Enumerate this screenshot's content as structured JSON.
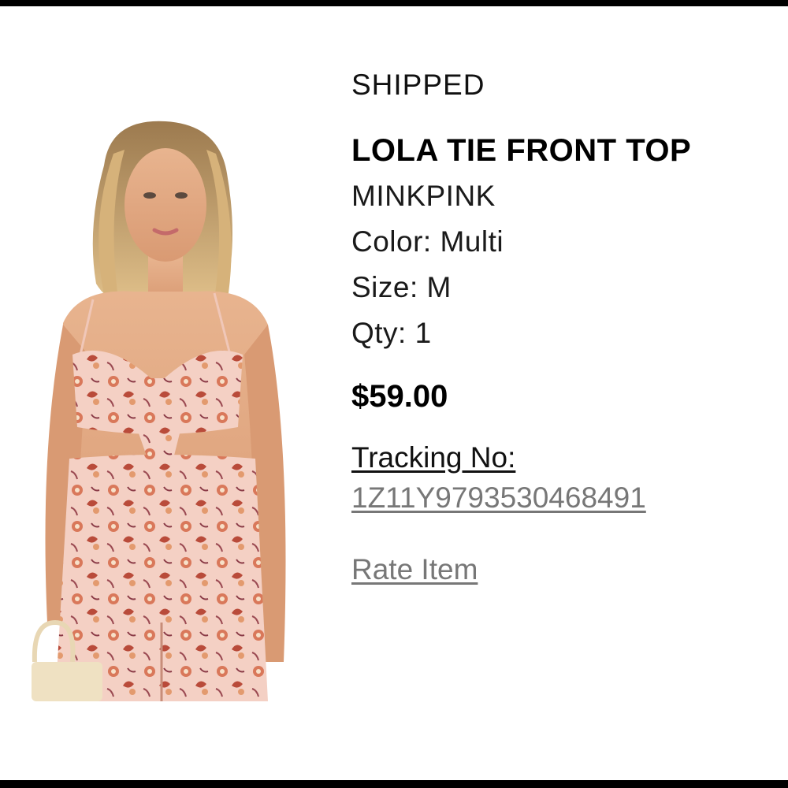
{
  "order_item": {
    "status": "SHIPPED",
    "product_name": "LOLA TIE FRONT TOP",
    "brand": "MINKPINK",
    "color": "Color: Multi",
    "size": "Size: M",
    "quantity": "Qty: 1",
    "price": "$59.00",
    "tracking_label": "Tracking No:",
    "tracking_number": "1Z11Y9793530468491",
    "rate_label": "Rate Item"
  },
  "colors": {
    "text": "#111111",
    "muted_link": "#777777",
    "rule": "#000000",
    "fabric": "#f3c9bd",
    "print_accent": "#c2543e"
  }
}
